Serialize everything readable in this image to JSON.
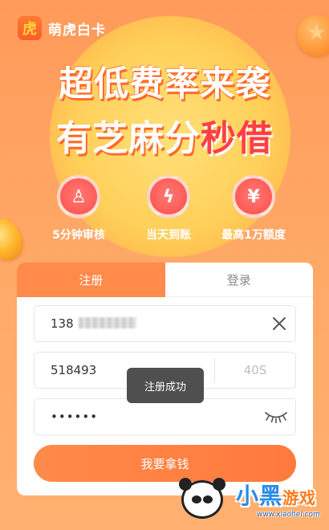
{
  "app": {
    "name": "萌虎白卡",
    "logo_glyph": "虎"
  },
  "banner": {
    "line1": "超低费率来袭",
    "line2_main": "有芝麻分",
    "line2_accent": "秒借"
  },
  "features": [
    {
      "icon": "stamp-icon",
      "glyph": "♙",
      "label": "5分钟审核"
    },
    {
      "icon": "lightning-icon",
      "glyph": "ϟ",
      "label": "当天到账"
    },
    {
      "icon": "yuan-icon",
      "glyph": "¥",
      "label": "最高1万额度"
    }
  ],
  "tabs": {
    "register": "注册",
    "login": "登录"
  },
  "form": {
    "phone_visible": "138",
    "code_value": "518493",
    "countdown": "40S",
    "password_masked": "••••••",
    "submit_label": "我要拿钱"
  },
  "toast": "注册成功",
  "watermark": {
    "text_main": "小黑",
    "text_game": "游戏",
    "url": "www.xiaohei.com"
  },
  "colors": {
    "accent": "#ff8a4a",
    "tab_active": "#ff8a4a",
    "danger": "#ff3f44"
  }
}
